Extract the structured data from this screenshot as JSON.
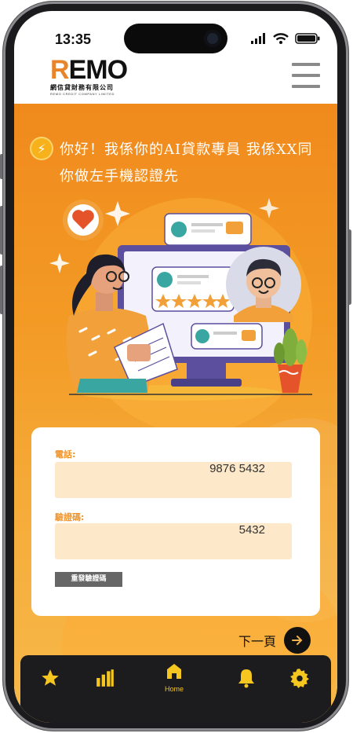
{
  "status_bar": {
    "time": "13:35"
  },
  "header": {
    "logo_mark_first": "R",
    "logo_mark_rest": "EMO",
    "logo_chinese": "網信貸財務有限公司",
    "logo_english": "REMO CREDIT COMPANY LIMITED",
    "menu_icon": "hamburger-menu-icon"
  },
  "greeting": {
    "icon": "lightning-bolt-icon",
    "text": "你好！我係你的AI貸款專員 我係XX同你做左手機認證先"
  },
  "illustration": {
    "rating_stars": 5,
    "icons": [
      "heart-icon",
      "thumbs-up-icon",
      "star-icon",
      "sparkle-icon"
    ]
  },
  "form": {
    "phone_label": "電話:",
    "phone_value": "9876 5432",
    "code_label": "驗證碼:",
    "code_value": "5432",
    "resend_label": "重發驗證碼"
  },
  "next": {
    "label": "下一頁",
    "icon": "arrow-right-icon"
  },
  "bottom_nav": {
    "items": [
      {
        "icon": "star-icon",
        "label": ""
      },
      {
        "icon": "bar-chart-icon",
        "label": ""
      },
      {
        "icon": "home-icon",
        "label": "Home"
      },
      {
        "icon": "bell-icon",
        "label": ""
      },
      {
        "icon": "gear-icon",
        "label": ""
      }
    ]
  },
  "colors": {
    "accent_orange": "#f08a1d",
    "field_bg": "#fde8c9",
    "nav_bg": "#1c1c1e",
    "nav_icon": "#f5c61f"
  }
}
